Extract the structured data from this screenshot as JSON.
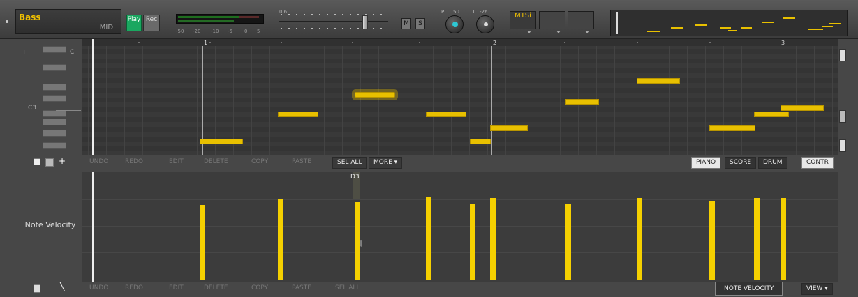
{
  "track": {
    "name": "Bass",
    "type": "MIDI"
  },
  "transport": {
    "play": "Play",
    "rec": "Rec"
  },
  "meter_scale": [
    "-50",
    "-20",
    "-10",
    "-5",
    "0",
    "5"
  ],
  "fader": {
    "label": "0.6"
  },
  "mute_label": "M",
  "solo_label": "S",
  "knobs": [
    {
      "letter": "P",
      "value": "50"
    },
    {
      "letter": "1",
      "value": "-26"
    }
  ],
  "instrument_label": "MTSi",
  "ruler": {
    "bars": [
      "1",
      "2",
      "3"
    ]
  },
  "keys": {
    "top_label": "C",
    "c3_label": "C3"
  },
  "edit_toolbar": {
    "undo": "UNDO",
    "redo": "REDO",
    "edit": "EDIT",
    "delete": "DELETE",
    "copy": "COPY",
    "paste": "PASTE",
    "sel_all": "SEL ALL",
    "more": "MORE"
  },
  "view_modes": {
    "piano": "PIANO",
    "score": "SCORE",
    "drum": "DRUM",
    "contr": "CONTR"
  },
  "controller": {
    "label": "Note Velocity",
    "hover_note": "D3",
    "selector": "NOTE VELOCITY",
    "view": "VIEW"
  },
  "colors": {
    "note": "#e8c000",
    "velocity": "#f5d000",
    "play_active": "#1aa760",
    "knob_accent": "#2ec8d4"
  }
}
